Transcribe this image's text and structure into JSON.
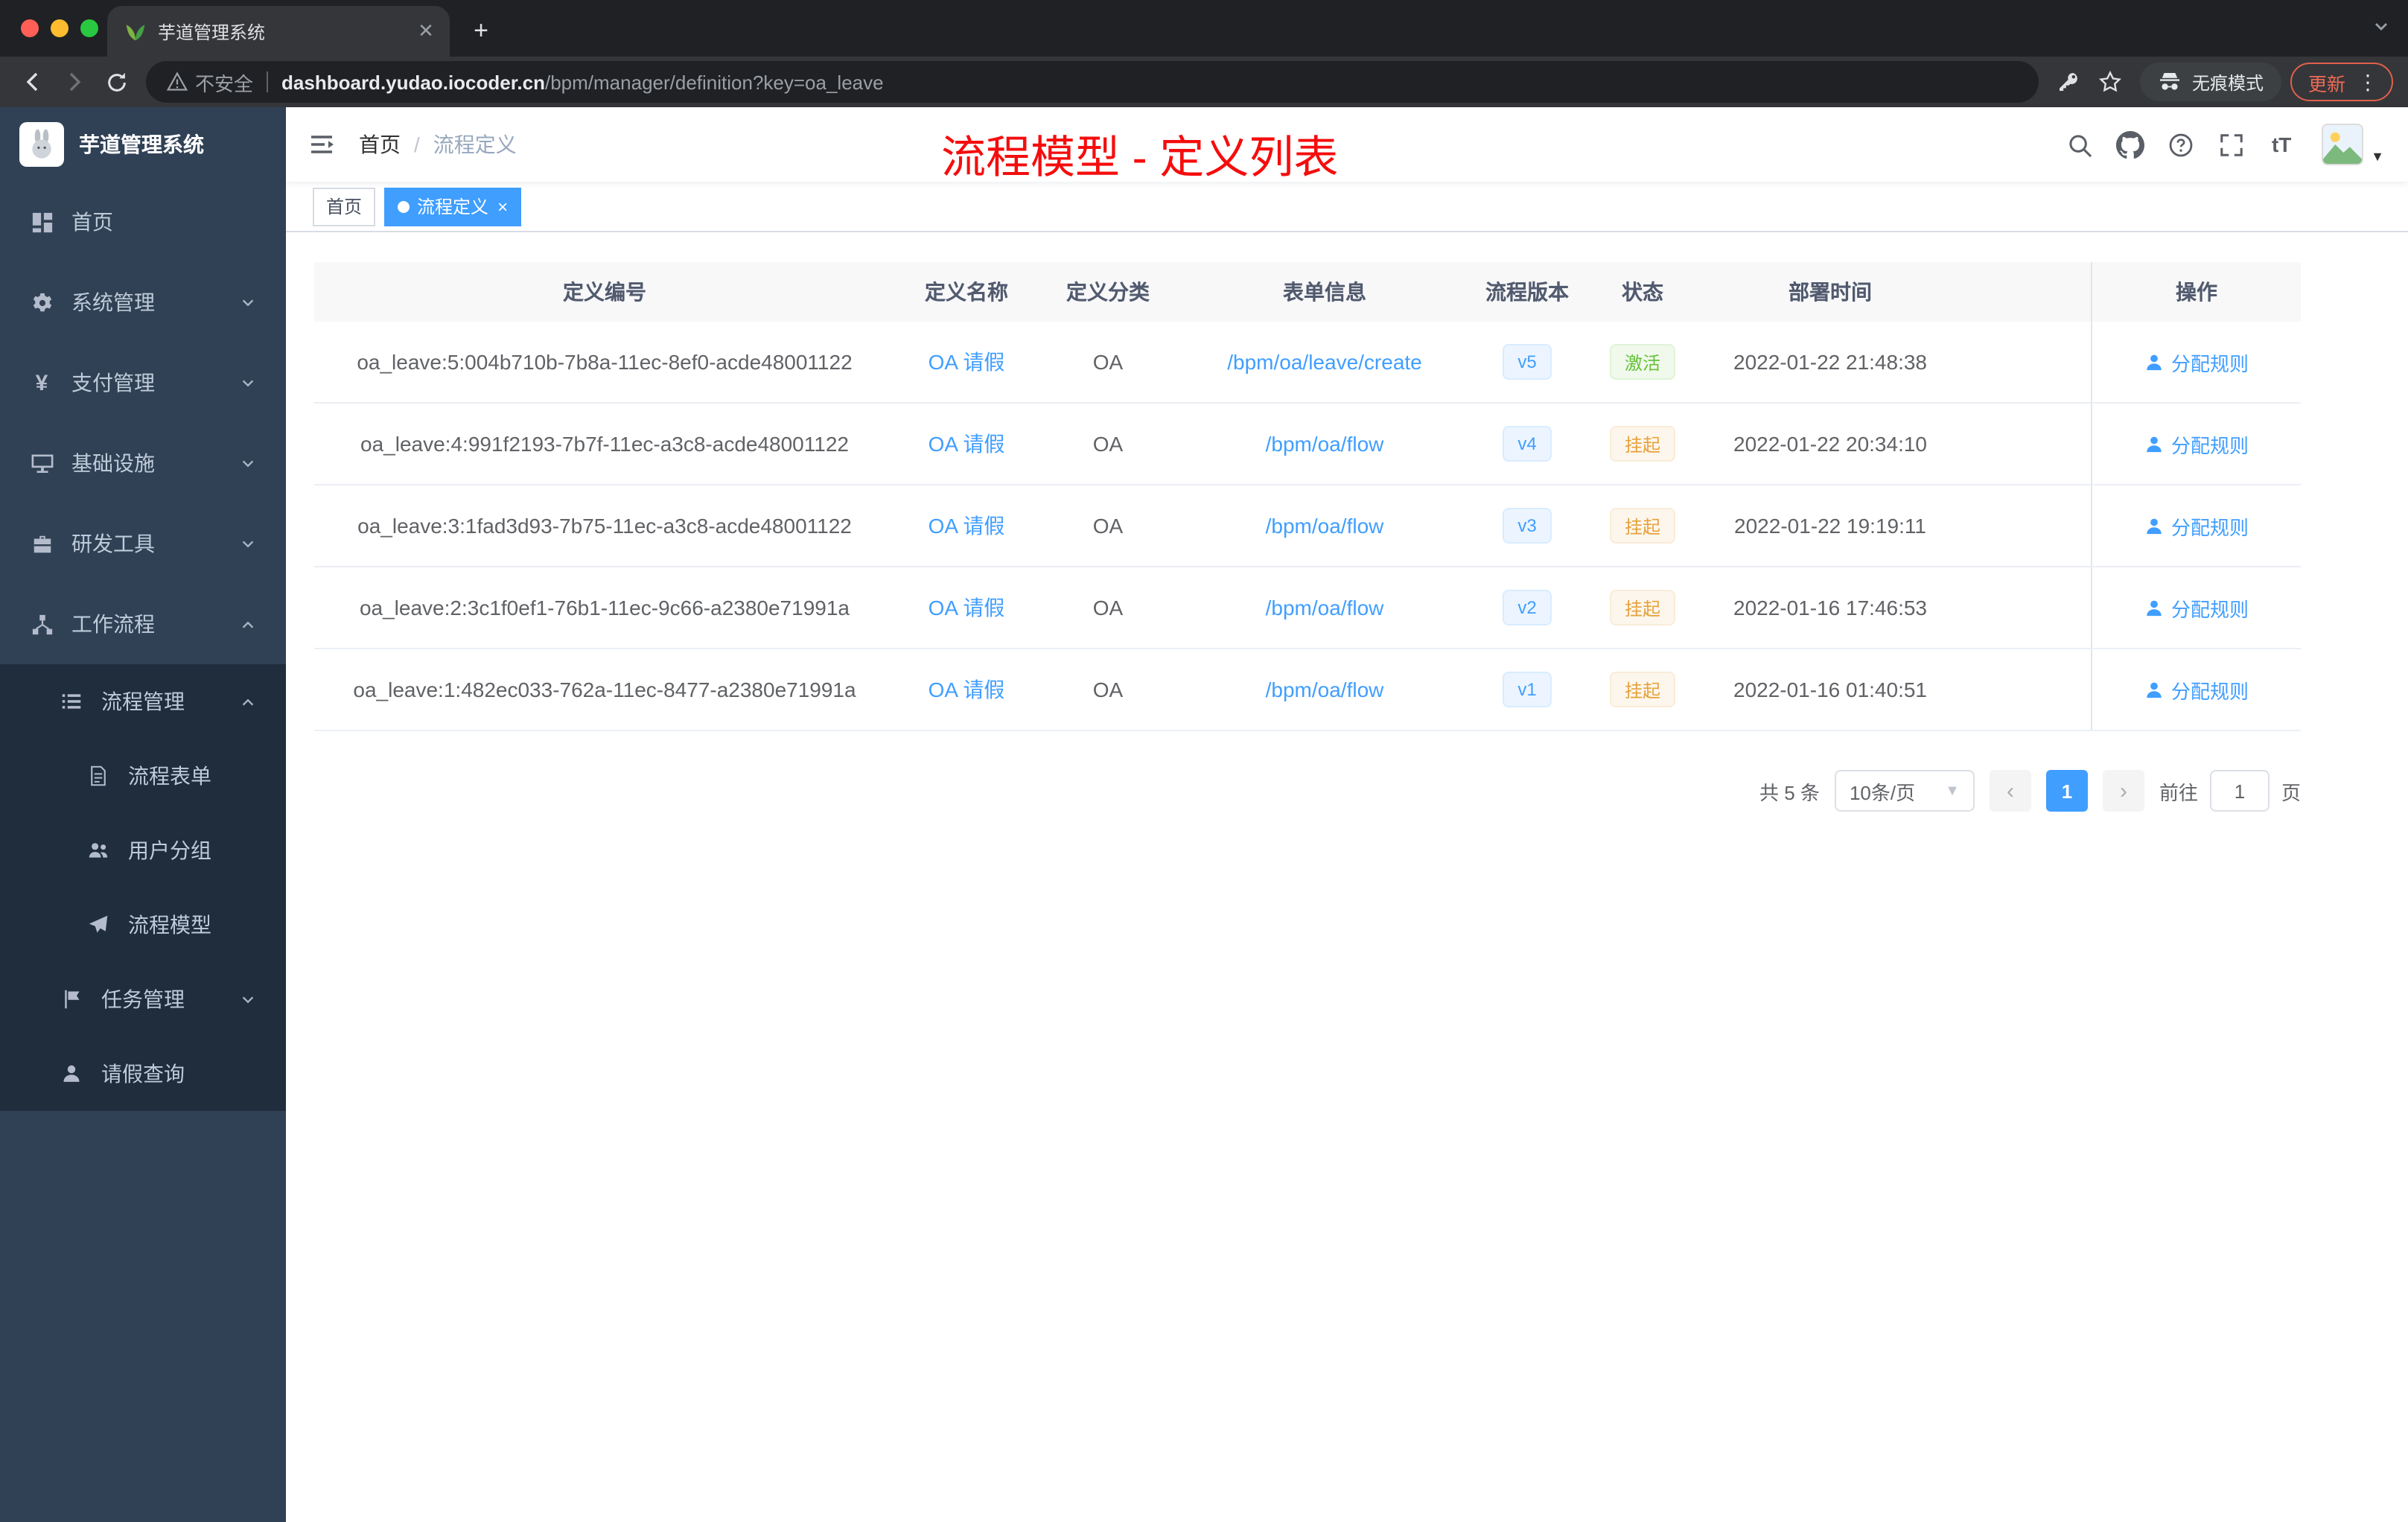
{
  "browser": {
    "tab_title": "芋道管理系统",
    "security_label": "不安全",
    "url_domain": "dashboard.yudao.iocoder.cn",
    "url_path": "/bpm/manager/definition?key=oa_leave",
    "incognito_label": "无痕模式",
    "update_label": "更新"
  },
  "sidebar": {
    "title": "芋道管理系统",
    "items": [
      {
        "label": "首页",
        "icon": "home-icon"
      },
      {
        "label": "系统管理",
        "icon": "gear-icon"
      },
      {
        "label": "支付管理",
        "icon": "payment-icon"
      },
      {
        "label": "基础设施",
        "icon": "infrastructure-icon"
      },
      {
        "label": "研发工具",
        "icon": "dev-tools-icon"
      },
      {
        "label": "工作流程",
        "icon": "workflow-icon"
      }
    ],
    "submenu": {
      "manage_label": "流程管理",
      "children": [
        {
          "label": "流程表单",
          "icon": "form-icon"
        },
        {
          "label": "用户分组",
          "icon": "user-group-icon"
        },
        {
          "label": "流程模型",
          "icon": "paper-plane-icon"
        }
      ],
      "task_label": "任务管理",
      "leave_label": "请假查询"
    }
  },
  "header": {
    "breadcrumb_home": "首页",
    "breadcrumb_current": "流程定义",
    "annotation": "流程模型 - 定义列表",
    "font_tool": "tT"
  },
  "tags": {
    "home": "首页",
    "active": "流程定义"
  },
  "table": {
    "headers": [
      "定义编号",
      "定义名称",
      "定义分类",
      "表单信息",
      "流程版本",
      "状态",
      "部署时间",
      "操作"
    ],
    "rows": [
      {
        "id": "oa_leave:5:004b710b-7b8a-11ec-8ef0-acde48001122",
        "name": "OA 请假",
        "category": "OA",
        "form": "/bpm/oa/leave/create",
        "version": "v5",
        "status": "激活",
        "status_type": "success",
        "deploy_time": "2022-01-22 21:48:38",
        "action": "分配规则"
      },
      {
        "id": "oa_leave:4:991f2193-7b7f-11ec-a3c8-acde48001122",
        "name": "OA 请假",
        "category": "OA",
        "form": "/bpm/oa/flow",
        "version": "v4",
        "status": "挂起",
        "status_type": "warning",
        "deploy_time": "2022-01-22 20:34:10",
        "action": "分配规则"
      },
      {
        "id": "oa_leave:3:1fad3d93-7b75-11ec-a3c8-acde48001122",
        "name": "OA 请假",
        "category": "OA",
        "form": "/bpm/oa/flow",
        "version": "v3",
        "status": "挂起",
        "status_type": "warning",
        "deploy_time": "2022-01-22 19:19:11",
        "action": "分配规则"
      },
      {
        "id": "oa_leave:2:3c1f0ef1-76b1-11ec-9c66-a2380e71991a",
        "name": "OA 请假",
        "category": "OA",
        "form": "/bpm/oa/flow",
        "version": "v2",
        "status": "挂起",
        "status_type": "warning",
        "deploy_time": "2022-01-16 17:46:53",
        "action": "分配规则"
      },
      {
        "id": "oa_leave:1:482ec033-762a-11ec-8477-a2380e71991a",
        "name": "OA 请假",
        "category": "OA",
        "form": "/bpm/oa/flow",
        "version": "v1",
        "status": "挂起",
        "status_type": "warning",
        "deploy_time": "2022-01-16 01:40:51",
        "action": "分配规则"
      }
    ]
  },
  "pagination": {
    "total": "共 5 条",
    "page_size": "10条/页",
    "current_page": "1",
    "goto_label": "前往",
    "goto_value": "1",
    "page_unit": "页"
  },
  "colors": {
    "primary": "#409eff",
    "success": "#67c23a",
    "warning": "#e6a23c",
    "annotation_red": "#f50d0d",
    "sidebar_bg": "#304156",
    "submenu_bg": "#1f2d3d"
  }
}
